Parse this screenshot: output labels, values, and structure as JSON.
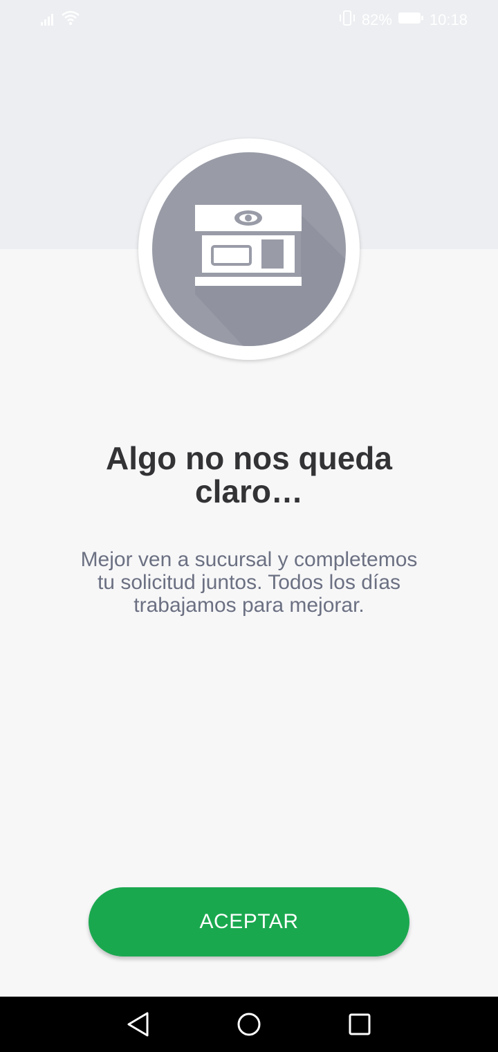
{
  "status_bar": {
    "battery": "82%",
    "time": "10:18",
    "icons": [
      "signal-icon",
      "wifi-icon",
      "vibrate-icon",
      "battery-icon"
    ]
  },
  "hero": {
    "icon": "bank-branch-icon"
  },
  "title": "Algo no nos queda claro…",
  "message": "Mejor ven a sucursal y completemos tu solicitud juntos. Todos los días trabajamos para mejorar.",
  "button": {
    "label": "ACEPTAR",
    "color": "#1aa84f"
  },
  "nav_bar": {
    "icons": [
      "back-icon",
      "home-icon",
      "recents-icon"
    ]
  },
  "colors": {
    "header_background": "#eceef1",
    "page_background": "#f7f7f8",
    "icon_circle": "#999ca7",
    "title_text": "#333336",
    "message_text": "#6b7082"
  }
}
